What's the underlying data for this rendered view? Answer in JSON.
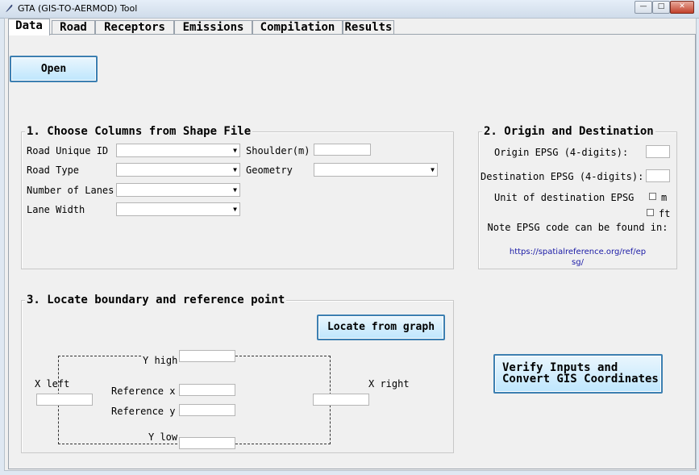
{
  "window": {
    "title": "GTA (GIS-TO-AERMOD) Tool",
    "controls": {
      "minimize": "—",
      "maximize": "□",
      "close": "✕"
    }
  },
  "tabs": [
    {
      "label": "Data",
      "active": true
    },
    {
      "label": "Road",
      "active": false
    },
    {
      "label": "Receptors",
      "active": false
    },
    {
      "label": "Emissions",
      "active": false
    },
    {
      "label": "Compilation",
      "active": false
    },
    {
      "label": "Results",
      "active": false
    }
  ],
  "open_button": "Open",
  "section1": {
    "title": "1. Choose Columns from Shape File",
    "road_unique_id": {
      "label": "Road Unique ID",
      "value": ""
    },
    "road_type": {
      "label": "Road Type",
      "value": ""
    },
    "number_of_lanes": {
      "label": "Number of Lanes",
      "value": ""
    },
    "lane_width": {
      "label": "Lane Width",
      "value": ""
    },
    "shoulder": {
      "label": "Shoulder(m)",
      "value": ""
    },
    "geometry": {
      "label": "Geometry",
      "value": ""
    }
  },
  "section2": {
    "title": "2. Origin and Destination",
    "origin_label": "Origin EPSG (4-digits):",
    "origin_value": "",
    "destination_label": "Destination EPSG (4-digits):",
    "destination_value": "",
    "unit_label": "Unit of destination EPSG",
    "unit_m": "m",
    "unit_ft": "ft",
    "unit_m_checked": false,
    "unit_ft_checked": false,
    "note": "Note EPSG code can be found in:",
    "link_line1": "https://spatialreference.org/ref/ep",
    "link_line2": "sg/"
  },
  "section3": {
    "title": "3. Locate boundary and reference point",
    "locate_button": "Locate from graph",
    "y_high_label": "Y high",
    "y_low_label": "Y low",
    "x_left_label": "X left",
    "x_right_label": "X right",
    "ref_x_label": "Reference x",
    "ref_y_label": "Reference y",
    "y_high": "",
    "y_low": "",
    "x_left": "",
    "x_right": "",
    "ref_x": "",
    "ref_y": ""
  },
  "verify_button": {
    "line1": "Verify Inputs and",
    "line2": "Convert GIS Coordinates"
  }
}
